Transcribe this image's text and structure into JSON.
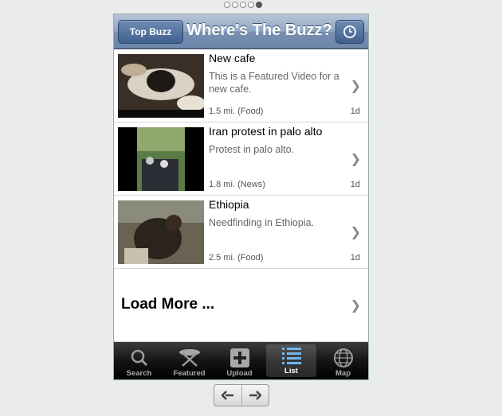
{
  "nav": {
    "title": "Where's The Buzz?",
    "top_buzz_label": "Top Buzz",
    "clock_icon": "clock-icon"
  },
  "items": [
    {
      "title": "New cafe",
      "description": "This is a Featured Video for a new cafe.",
      "meta": "1.5 mi. (Food)",
      "age": "1d"
    },
    {
      "title": "Iran protest in palo alto",
      "description": "Protest in palo alto.",
      "meta": "1.8 mi. (News)",
      "age": "1d"
    },
    {
      "title": "Ethiopia",
      "description": "Needfinding in Ethiopia.",
      "meta": "2.5 mi. (Food)",
      "age": "1d"
    }
  ],
  "load_more": "Load More ...",
  "tabs": [
    {
      "label": "Search",
      "icon": "search-icon"
    },
    {
      "label": "Featured",
      "icon": "featured-icon"
    },
    {
      "label": "Upload",
      "icon": "upload-icon"
    },
    {
      "label": "List",
      "icon": "list-icon",
      "selected": true
    },
    {
      "label": "Map",
      "icon": "globe-icon"
    }
  ],
  "colors": {
    "navbar": "#7890b1",
    "tabbar": "#151515",
    "accent": "#4a6a98"
  }
}
